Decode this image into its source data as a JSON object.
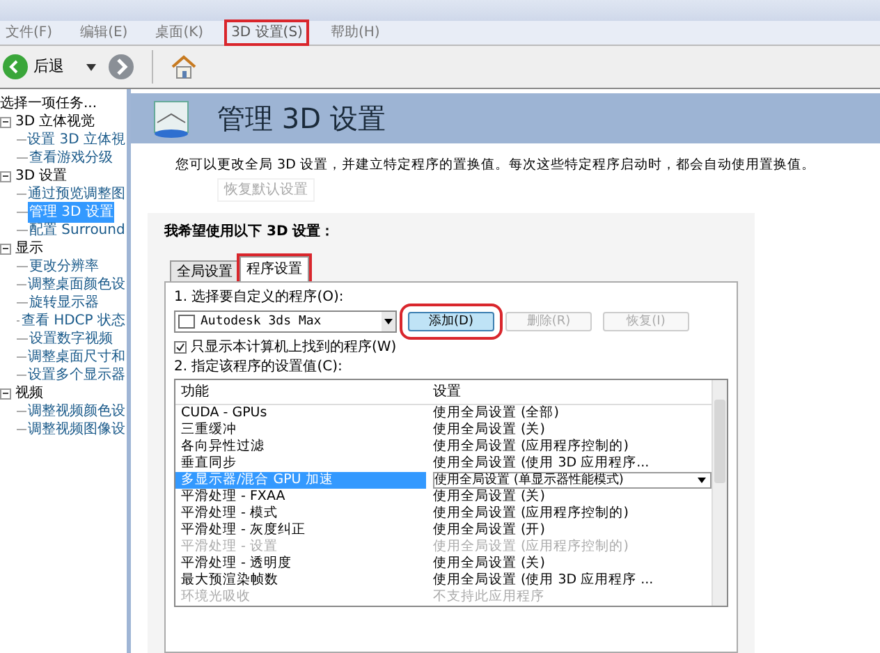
{
  "menu": [
    {
      "label": "文件(F)",
      "selected": false
    },
    {
      "label": "编辑(E)",
      "selected": false
    },
    {
      "label": "桌面(K)",
      "selected": false
    },
    {
      "label": "3D 设置(S)",
      "selected": true
    },
    {
      "label": "帮助(H)",
      "selected": false
    }
  ],
  "toolbar": {
    "back": "后退"
  },
  "sidebar": {
    "title": "选择一项任务...",
    "items": [
      {
        "label": "3D 立体视觉",
        "children": [
          {
            "label": "设置 3D 立体視",
            "selected": false
          },
          {
            "label": "查看游戏分级",
            "selected": false
          }
        ]
      },
      {
        "label": "3D 设置",
        "children": [
          {
            "label": "通过预览调整图",
            "selected": false
          },
          {
            "label": "管理 3D 设置",
            "selected": true
          },
          {
            "label": "配置 Surround",
            "selected": false
          }
        ]
      },
      {
        "label": "显示",
        "children": [
          {
            "label": "更改分辨率",
            "selected": false
          },
          {
            "label": "调整桌面颜色设",
            "selected": false
          },
          {
            "label": "旋转显示器",
            "selected": false
          },
          {
            "label": "查看 HDCP 状态",
            "selected": false
          },
          {
            "label": "设置数字视频",
            "selected": false
          },
          {
            "label": "调整桌面尺寸和",
            "selected": false
          },
          {
            "label": "设置多个显示器",
            "selected": false
          }
        ]
      },
      {
        "label": "视频",
        "children": [
          {
            "label": "调整视频颜色设",
            "selected": false
          },
          {
            "label": "调整视频图像设",
            "selected": false
          }
        ]
      }
    ]
  },
  "page": {
    "title": "管理 3D 设置",
    "description": "您可以更改全局 3D 设置，并建立特定程序的置换值。每次这些特定程序启动时，都会自动使用置换值。",
    "restore": "恢复默认设置"
  },
  "panel": {
    "heading": "我希望使用以下 3D 设置：",
    "tabs": [
      {
        "label": "全局设置",
        "selected": false
      },
      {
        "label": "程序设置",
        "selected": true
      }
    ],
    "step1": "1. 选择要自定义的程序(O):",
    "program": "Autodesk 3ds Max",
    "buttons": [
      {
        "label": "添加(D)",
        "disabled": false
      },
      {
        "label": "删除(R)",
        "disabled": true
      },
      {
        "label": "恢复(I)",
        "disabled": true
      }
    ],
    "show_local": {
      "label": "只显示本计算机上找到的程序(W)",
      "checked": true
    },
    "step2": "2. 指定该程序的设置值(C):",
    "table": {
      "columns": [
        "功能",
        "设置"
      ],
      "rows": [
        {
          "feature": "CUDA - GPUs",
          "setting": "使用全局设置 (全部)",
          "selected": false,
          "disabled": false
        },
        {
          "feature": "三重缓冲",
          "setting": "使用全局设置 (关)",
          "selected": false,
          "disabled": false
        },
        {
          "feature": "各向异性过滤",
          "setting": "使用全局设置 (应用程序控制的)",
          "selected": false,
          "disabled": false
        },
        {
          "feature": "垂直同步",
          "setting": "使用全局设置 (使用 3D 应用程序...",
          "selected": false,
          "disabled": false
        },
        {
          "feature": "多显示器/混合 GPU 加速",
          "setting": "使用全局设置 (单显示器性能模式)",
          "selected": true,
          "disabled": false
        },
        {
          "feature": "平滑处理 - FXAA",
          "setting": "使用全局设置 (关)",
          "selected": false,
          "disabled": false
        },
        {
          "feature": "平滑处理 - 模式",
          "setting": "使用全局设置 (应用程序控制的)",
          "selected": false,
          "disabled": false
        },
        {
          "feature": "平滑处理 - 灰度纠正",
          "setting": "使用全局设置 (开)",
          "selected": false,
          "disabled": false
        },
        {
          "feature": "平滑处理 - 设置",
          "setting": "使用全局设置 (应用程序控制的)",
          "selected": false,
          "disabled": true
        },
        {
          "feature": "平滑处理 - 透明度",
          "setting": "使用全局设置 (关)",
          "selected": false,
          "disabled": false
        },
        {
          "feature": "最大预渲染帧数",
          "setting": "使用全局设置 (使用 3D 应用程序 ...",
          "selected": false,
          "disabled": false
        },
        {
          "feature": "环境光吸收",
          "setting": "不支持此应用程序",
          "selected": false,
          "disabled": true
        }
      ]
    }
  }
}
